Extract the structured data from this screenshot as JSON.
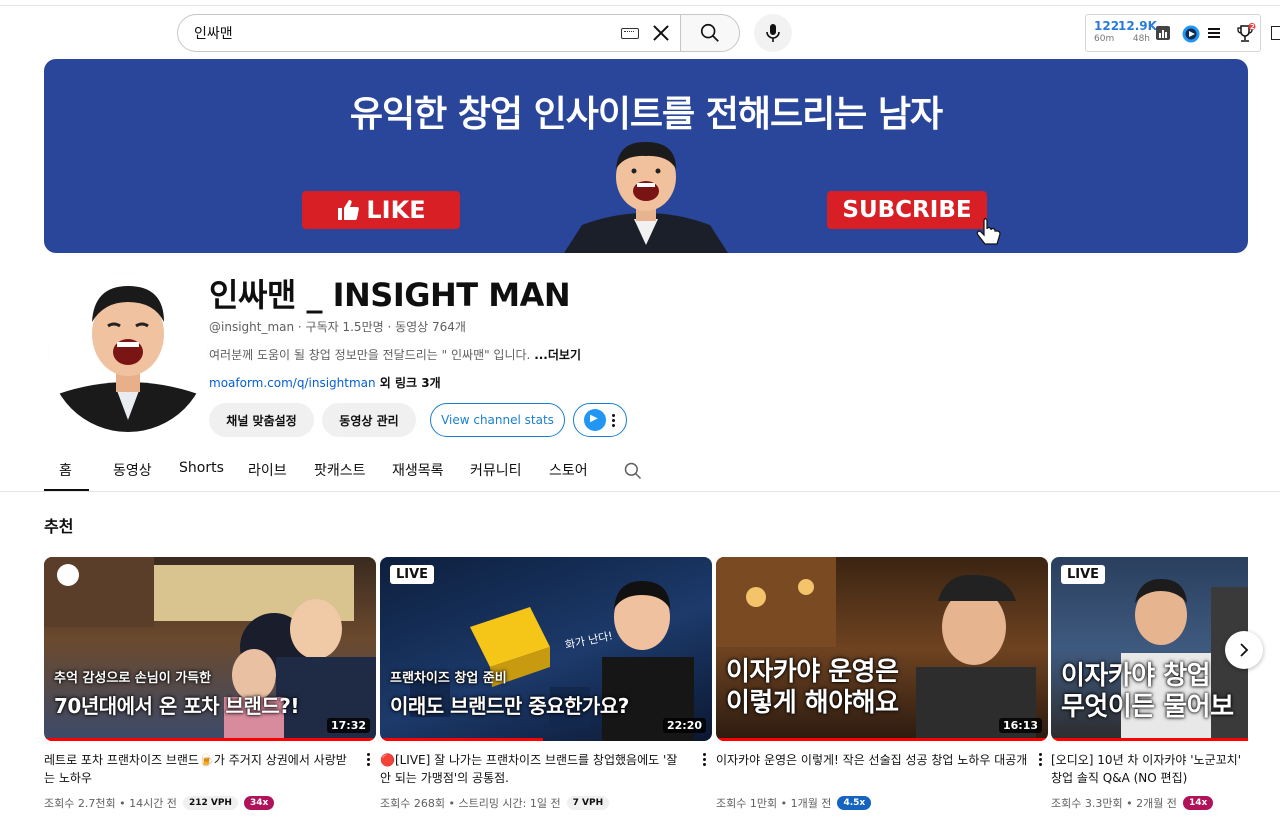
{
  "search": {
    "query": "인싸맨"
  },
  "stats": {
    "a_value": "122",
    "a_period": "60m",
    "b_value": "12.9K",
    "b_period": "48h",
    "notif_count": "2"
  },
  "banner": {
    "title": "유익한 창업 인사이트를 전해드리는 남자",
    "like_label": "LIKE",
    "subscribe_label": "SUBCRIBE"
  },
  "channel": {
    "name": "인싸맨 _ INSIGHT MAN",
    "meta": "@insight_man · 구독자 1.5만명 · 동영상 764개",
    "description": "여러분께 도움이 될 창업 정보만을 전달드리는 \" 인싸맨\" 입니다. ",
    "more_label": "...더보기",
    "link_url": "moaform.com/q/insightman",
    "link_extra": " 외 링크 3개",
    "buttons": {
      "customize": "채널 맞춤설정",
      "manage": "동영상 관리",
      "stats": "View channel stats"
    }
  },
  "tabs": [
    "홈",
    "동영상",
    "Shorts",
    "라이브",
    "팟캐스트",
    "재생목록",
    "커뮤니티",
    "스토어"
  ],
  "section_title": "추천",
  "colors": {
    "banner_bg": "#29469a",
    "brand_red": "#d81f26",
    "link_blue": "#065fd4"
  },
  "videos": [
    {
      "title": "레트로 포차 프랜차이즈 브랜드🍺가 주거지 상권에서 사랑받는 노하우",
      "caption_small": "추억 감성으로 손님이 가득한",
      "caption_large": "70년대에서 온 포차 브랜드?!",
      "duration": "17:32",
      "meta": "조회수 2.7천회 • 14시간 전",
      "vph": "212 VPH",
      "multiplier": "34x",
      "mult_color": "#b0135a"
    },
    {
      "title": "🔴[LIVE] 잘 나가는 프랜차이즈 브랜드를 창업했음에도 '잘 안 되는 가맹점'의 공통점.",
      "live_label": "LIVE",
      "caption_small": "프랜차이즈 창업 준비",
      "caption_large": "이래도 브랜드만 중요한가요?",
      "duration": "22:20",
      "meta": "조회수 268회 • 스트리밍 시간: 1일 전",
      "vph": "7 VPH",
      "multiplier": ""
    },
    {
      "title": "이자카야 운영은 이렇게! 작은 선술집 성공 창업 노하우 대공개",
      "caption_line1": "이자카야 운영은",
      "caption_line2": "이렇게 해야해요",
      "duration": "16:13",
      "meta": "조회수 1만회 • 1개월 전",
      "multiplier": "4.5x",
      "mult_color": "#1565c0"
    },
    {
      "title": "[오디오] 10년 차 이자카야 '노군꼬치' 창업 솔직 Q&A (NO 편집)",
      "live_label": "LIVE",
      "caption_line1": "이자카야 창업",
      "caption_line2": "무엇이든 물어보",
      "meta": "조회수 3.3만회 • 2개월 전",
      "multiplier": "14x",
      "mult_color": "#b0135a"
    }
  ]
}
